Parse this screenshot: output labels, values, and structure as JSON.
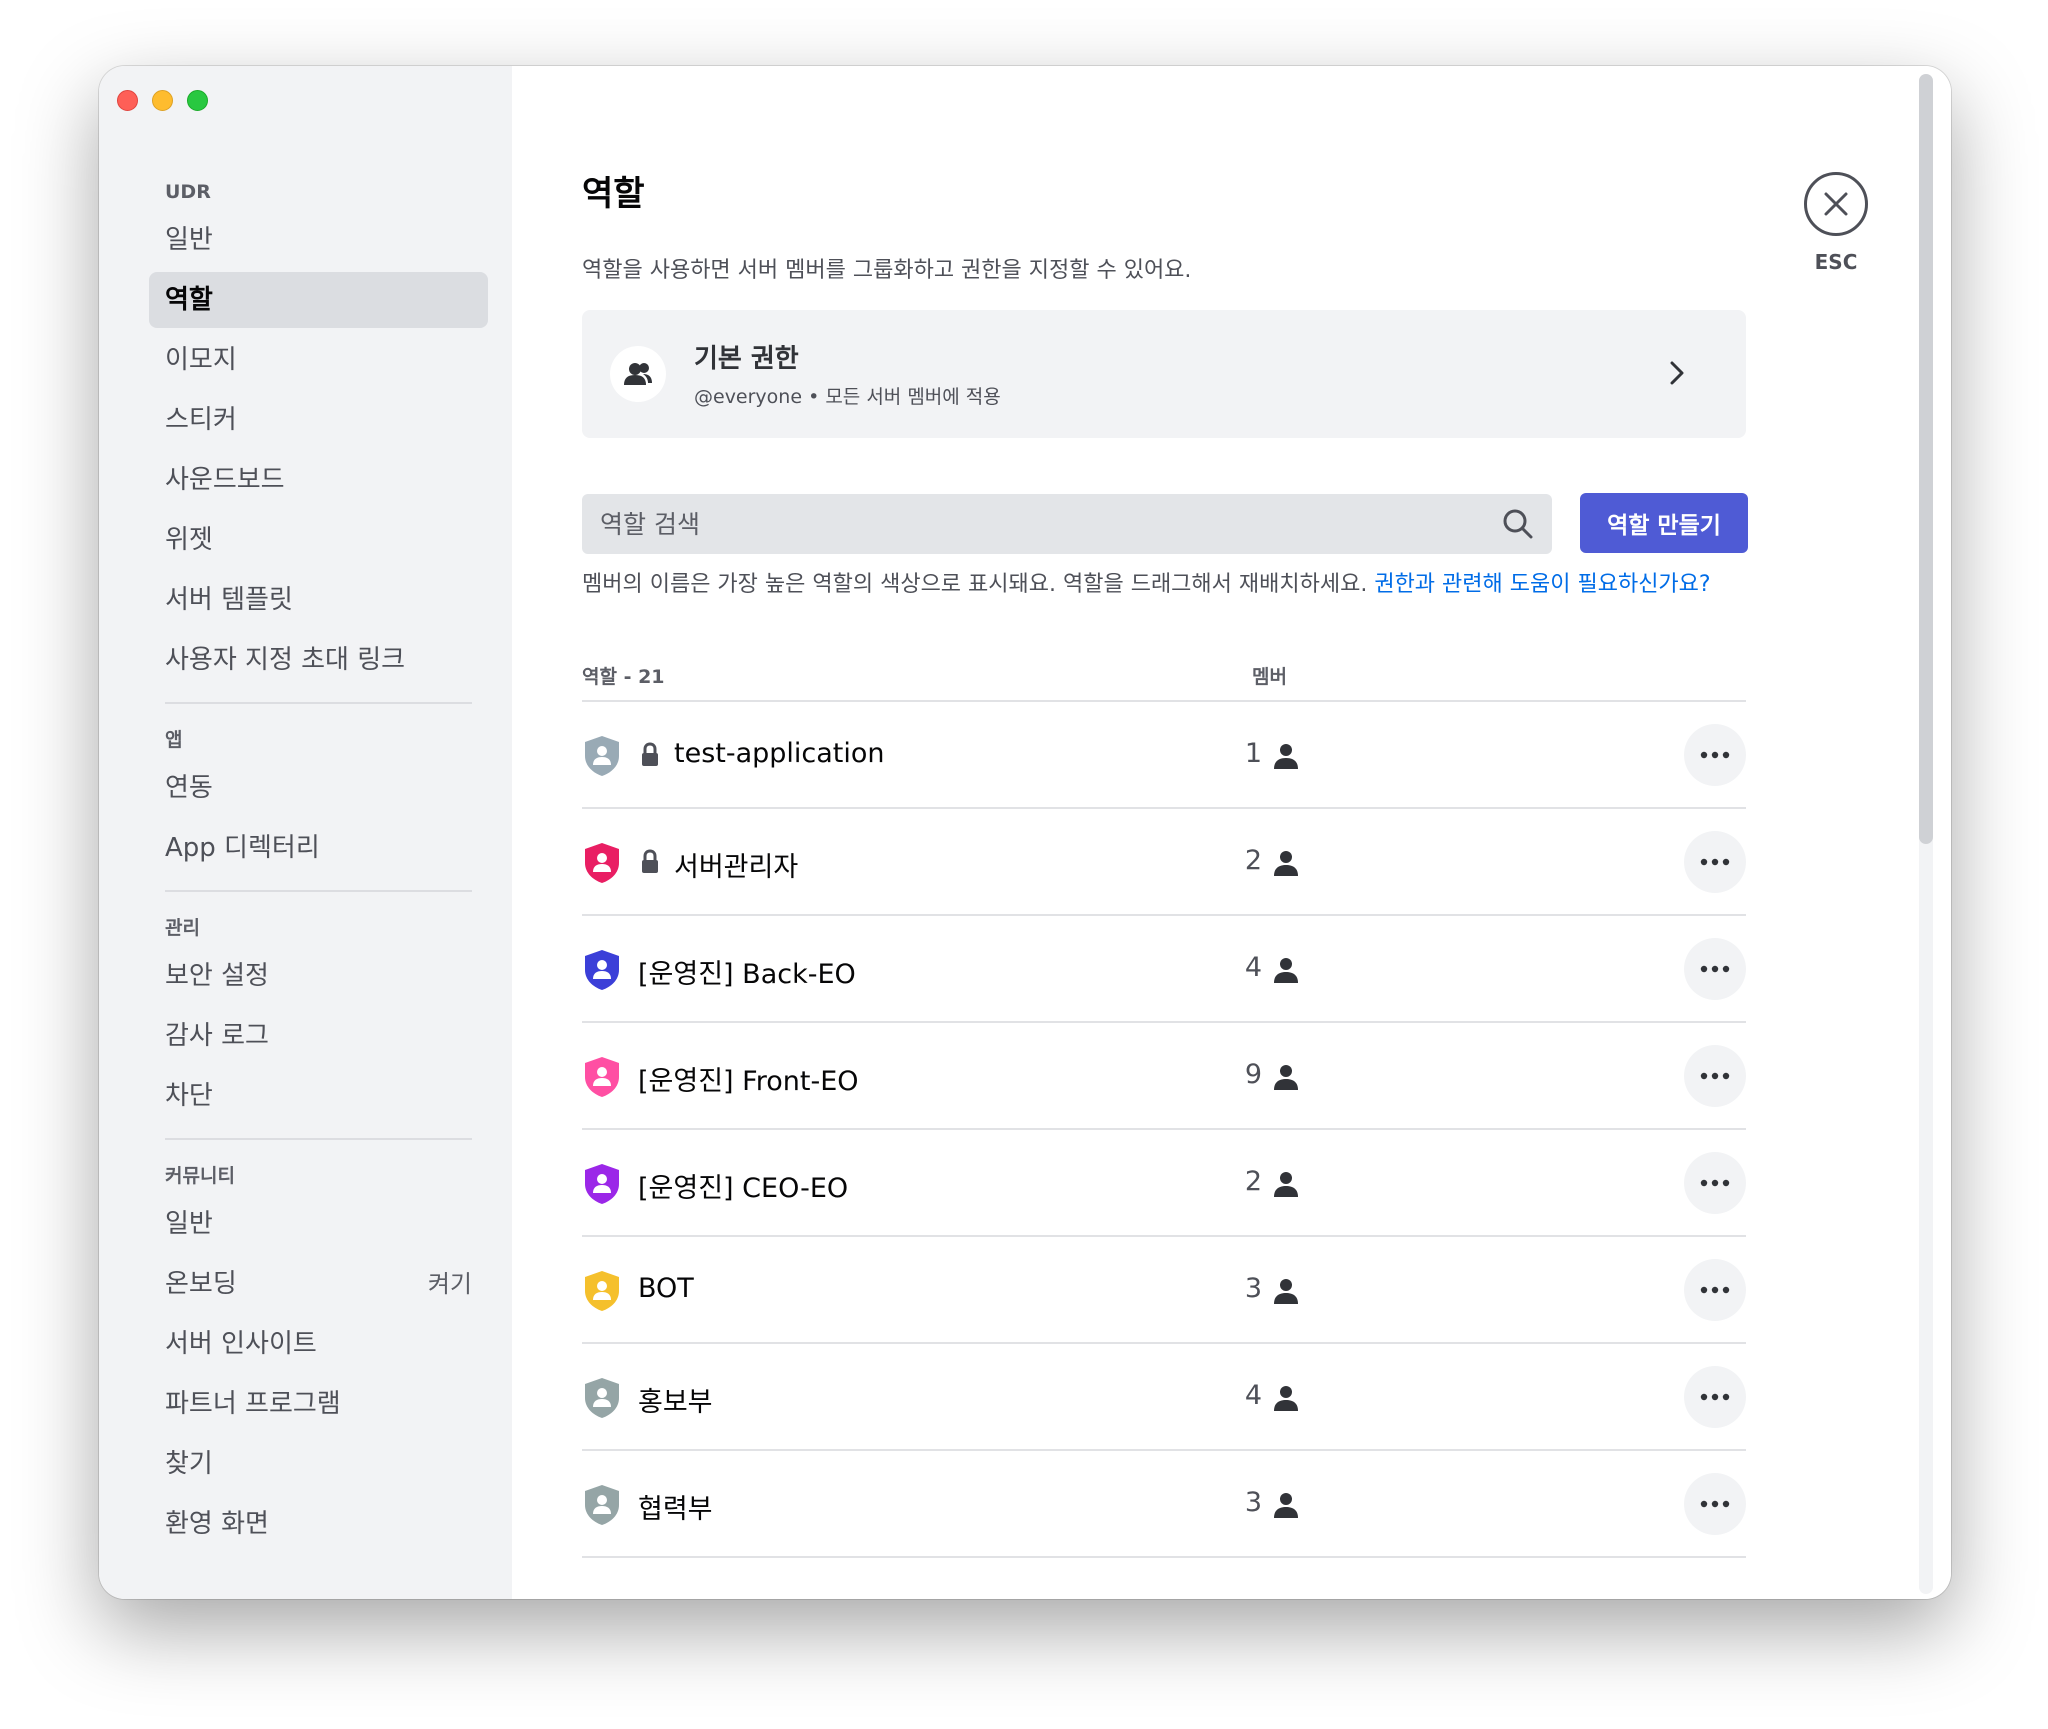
{
  "sidebar": {
    "sections": [
      {
        "title": "UDR",
        "items": [
          {
            "label": "일반"
          },
          {
            "label": "역할",
            "active": true
          },
          {
            "label": "이모지"
          },
          {
            "label": "스티커"
          },
          {
            "label": "사운드보드"
          },
          {
            "label": "위젯"
          },
          {
            "label": "서버 템플릿"
          },
          {
            "label": "사용자 지정 초대 링크"
          }
        ]
      },
      {
        "title": "앱",
        "items": [
          {
            "label": "연동"
          },
          {
            "label": "App 디렉터리"
          }
        ]
      },
      {
        "title": "관리",
        "items": [
          {
            "label": "보안 설정"
          },
          {
            "label": "감사 로그"
          },
          {
            "label": "차단"
          }
        ]
      },
      {
        "title": "커뮤니티",
        "items": [
          {
            "label": "일반"
          },
          {
            "label": "온보딩",
            "badge": "켜기"
          },
          {
            "label": "서버 인사이트"
          },
          {
            "label": "파트너 프로그램"
          },
          {
            "label": "찾기"
          },
          {
            "label": "환영 화면"
          }
        ]
      }
    ]
  },
  "main": {
    "title": "역할",
    "description": "역할을 사용하면 서버 멤버를 그룹화하고 권한을 지정할 수 있어요.",
    "default_permissions": {
      "title": "기본 권한",
      "subtitle": "@everyone • 모든 서버 멤버에 적용"
    },
    "search": {
      "placeholder": "역할 검색"
    },
    "create_button": "역할 만들기",
    "help_text": "멤버의 이름은 가장 높은 역할의 색상으로 표시돼요. 역할을 드래그해서 재배치하세요. ",
    "help_link": "권한과 관련해 도움이 필요하신가요?",
    "table": {
      "roles_header": "역할 - 21",
      "members_header": "멤버"
    },
    "roles": [
      {
        "name": "test-application",
        "count": "1",
        "color": "#99aab5",
        "locked": true
      },
      {
        "name": "서버관리자",
        "count": "2",
        "color": "#e91e63",
        "locked": true
      },
      {
        "name": "[운영진] Back-EO",
        "count": "4",
        "color": "#3b3fd8",
        "locked": false
      },
      {
        "name": "[운영진] Front-EO",
        "count": "9",
        "color": "#ff4fa3",
        "locked": false
      },
      {
        "name": "[운영진] CEO-EO",
        "count": "2",
        "color": "#9b27e8",
        "locked": false
      },
      {
        "name": "BOT",
        "count": "3",
        "color": "#f5c02c",
        "locked": false
      },
      {
        "name": "홍보부",
        "count": "4",
        "color": "#95a5a6",
        "locked": false
      },
      {
        "name": "협력부",
        "count": "3",
        "color": "#95a5a6",
        "locked": false
      }
    ]
  },
  "close": {
    "label": "ESC"
  }
}
